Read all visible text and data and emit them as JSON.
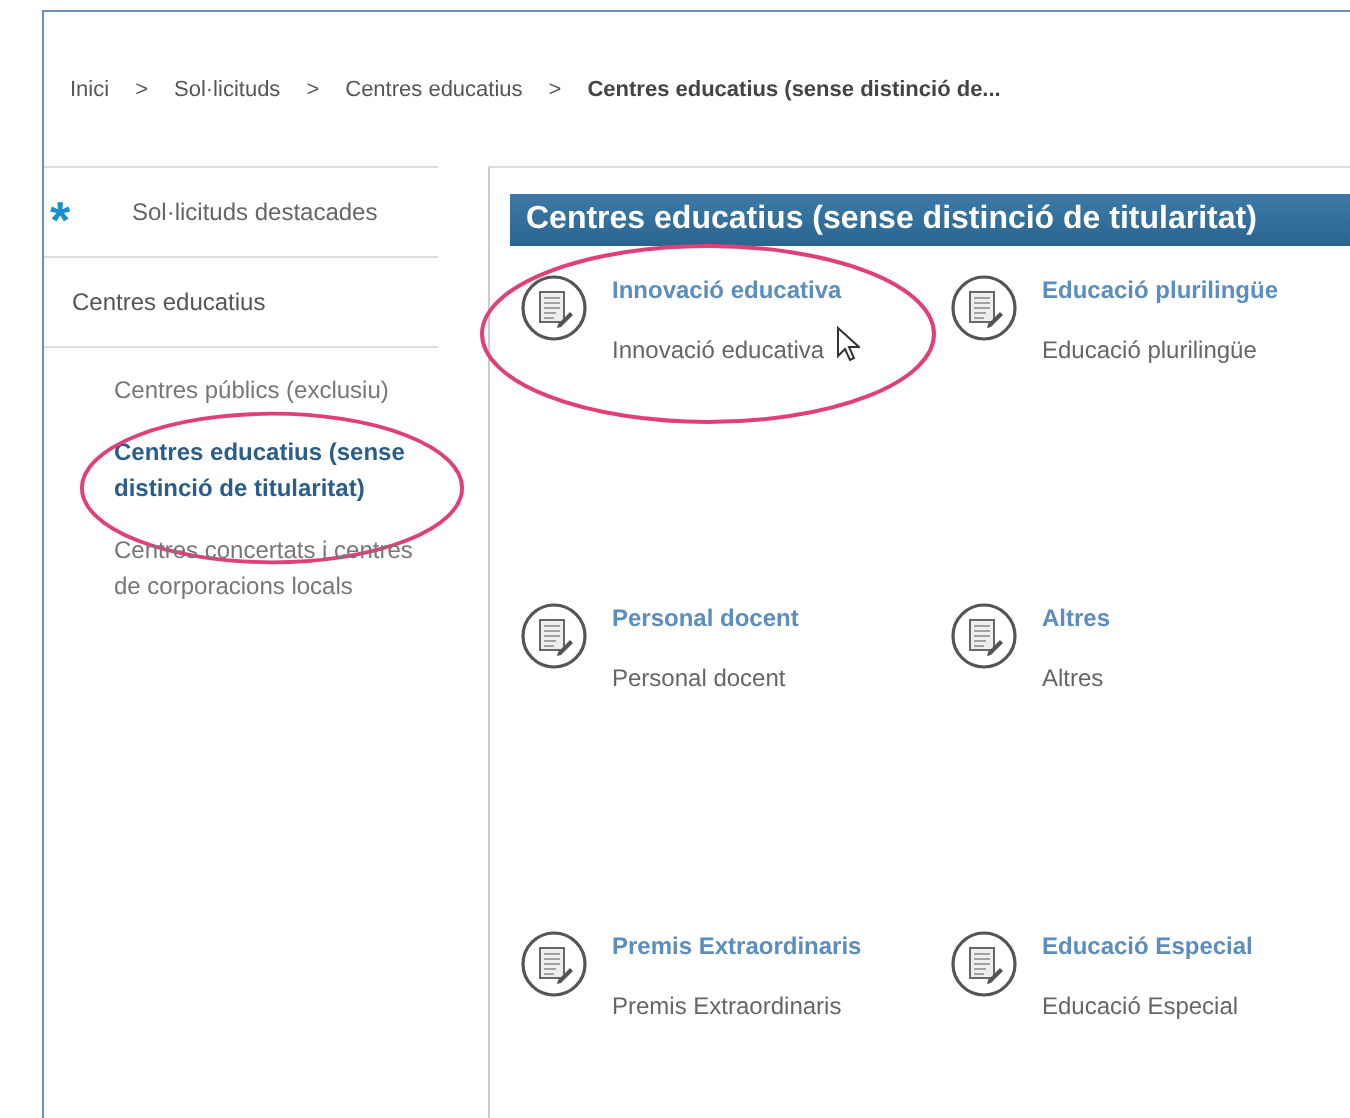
{
  "breadcrumb": [
    {
      "label": "Inici",
      "current": false
    },
    {
      "label": "Sol·licituds",
      "current": false
    },
    {
      "label": "Centres educatius",
      "current": false
    },
    {
      "label": "Centres educatius (sense distinció de...",
      "current": true
    }
  ],
  "breadcrumb_separator": ">",
  "sidebar": {
    "featured": {
      "icon": "*",
      "label": "Sol·licituds destacades"
    },
    "section": "Centres educatius",
    "items": [
      {
        "label": "Centres públics (exclusiu)",
        "selected": false,
        "highlighted": false
      },
      {
        "label": "Centres educatius (sense distinció de titularitat)",
        "selected": true,
        "highlighted": true
      },
      {
        "label": "Centres concertats i centres de corporacions locals",
        "selected": false,
        "highlighted": false
      }
    ]
  },
  "main": {
    "title": "Centres educatius (sense distinció de titularitat)",
    "cards": [
      {
        "title": "Innovació educativa",
        "description": "Innovació educativa",
        "highlighted": true,
        "hovered": true
      },
      {
        "title": "Educació plurilingüe",
        "description": "Educació plurilingüe",
        "highlighted": false,
        "hovered": false
      },
      {
        "title": "Personal docent",
        "description": "Personal docent",
        "highlighted": false,
        "hovered": false
      },
      {
        "title": "Altres",
        "description": "Altres",
        "highlighted": false,
        "hovered": false
      },
      {
        "title": "Premis Extraordinaris",
        "description": "Premis Extraordinaris",
        "highlighted": false,
        "hovered": false
      },
      {
        "title": "Educació Especial",
        "description": "Educació Especial",
        "highlighted": false,
        "hovered": false
      }
    ]
  }
}
